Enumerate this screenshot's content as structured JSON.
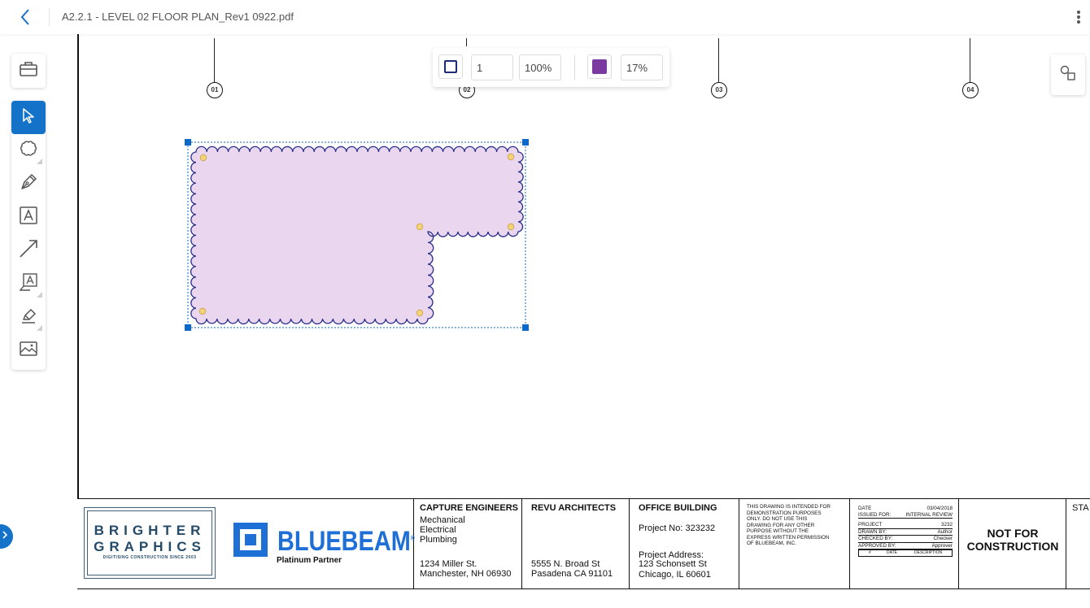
{
  "header": {
    "document_title": "A2.2.1 - LEVEL 02 FLOOR PLAN_Rev1 0922.pdf"
  },
  "grid_bubbles": [
    "01",
    "02",
    "03",
    "04"
  ],
  "properties_bar": {
    "stroke_color": "#1e2a78",
    "line_width": "1",
    "stroke_opacity": "100%",
    "fill_color": "#7a3aa0",
    "fill_opacity": "17%"
  },
  "markup": {
    "fill_color": "#ead6ef",
    "stroke_color": "#2a2f8a",
    "selection_color": "#0a68c8",
    "vertex_color": "#f3d27a"
  },
  "tools": [
    "toolbox",
    "select",
    "cloud",
    "pen",
    "text",
    "arrow",
    "callout",
    "highlighter",
    "image"
  ],
  "title_block": {
    "logo_line1": "BRIGHTER",
    "logo_line2": "GRAPHICS",
    "logo_tagline": "DIGITISING CONSTRUCTION SINCE 2003",
    "bluebeam_name": "BLUEBEAM",
    "bluebeam_reg": "®",
    "bluebeam_partner": "Platinum Partner",
    "engineer_name": "CAPTURE ENGINEERS",
    "engineer_services": [
      "Mechanical",
      "Electrical",
      "Plumbing"
    ],
    "engineer_address_1": "1234 Miller St.",
    "engineer_address_2": "Manchester, NH 06930",
    "architect_name": "REVU ARCHITECTS",
    "architect_address_1": "5555 N. Broad St",
    "architect_address_2": "Pasadena CA 91101",
    "project_title": "OFFICE BUILDING",
    "project_no": "Project No: 323232",
    "project_address_label": "Project Address:",
    "project_address_1": "123 Schonsett St",
    "project_address_2": "Chicago, IL 60601",
    "disclaimer": [
      "THIS DRAWING IS INTENDED FOR",
      "DEMONSTRATION PURPOSES",
      "ONLY.  DO NOT USE THIS",
      "DRAWING FOR ANY OTHER",
      "PURPOSE WITHOUT THE",
      "EXPRESS WRITTEN PERMISSION",
      "OF BLUEBEAM, INC."
    ],
    "info": {
      "date_label": "DATE",
      "date_value": "03/04/2018",
      "issued_label": "ISSUED FOR:",
      "issued_value": "INTERNAL REVIEW",
      "project_label": "PROJECT",
      "project_value": "3232",
      "drawn_label": "DRAWN BY:",
      "drawn_value": "Author",
      "checked_label": "CHECKED BY:",
      "checked_value": "Checker",
      "approved_label": "APPROVED BY:",
      "approved_value": "Approver",
      "rev_headers": [
        "#",
        "DATE",
        "DESCRIPTION"
      ]
    },
    "status_line1": "NOT FOR",
    "status_line2": "CONSTRUCTION",
    "stamp_partial": "STA"
  }
}
